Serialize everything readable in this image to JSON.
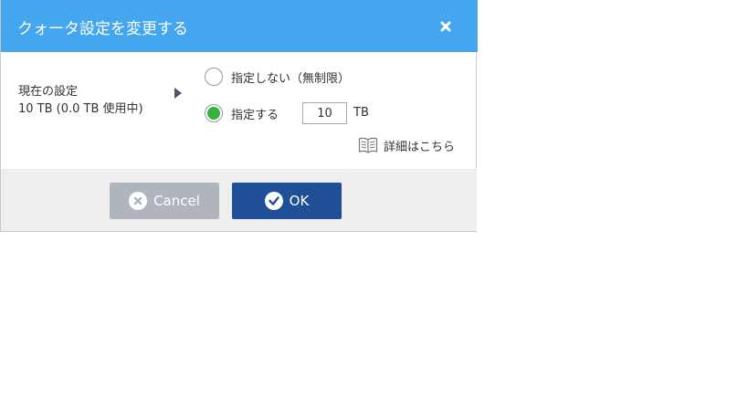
{
  "dialog": {
    "title": "クォータ設定を変更する"
  },
  "current": {
    "label": "現在の設定",
    "value": "10 TB (0.0 TB 使用中)"
  },
  "options": {
    "unlimited_label": "指定しない（無制限）",
    "specify_label": "指定する",
    "selected": "specify"
  },
  "quota": {
    "value": "10",
    "unit": "TB"
  },
  "details": {
    "label": "詳細はこちら",
    "icon": "book-icon"
  },
  "buttons": {
    "cancel_label": "Cancel",
    "ok_label": "OK"
  },
  "colors": {
    "titlebar": "#45a6f0",
    "radio_selected": "#33b33d",
    "ok_button": "#1e4f97",
    "cancel_button": "#b0b5bd"
  }
}
